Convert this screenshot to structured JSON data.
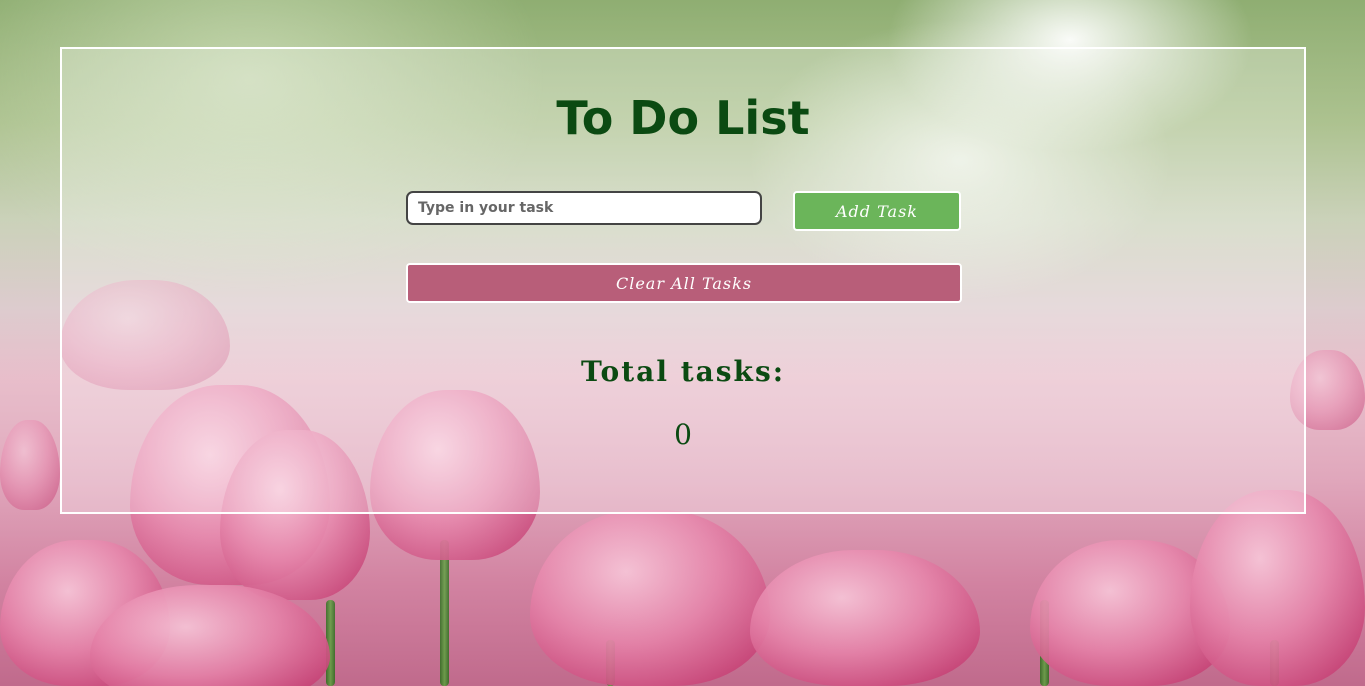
{
  "app": {
    "title": "To Do List"
  },
  "form": {
    "task_input": {
      "value": "",
      "placeholder": "Type in your task"
    },
    "add_button_label": "Add Task",
    "clear_button_label": "Clear All Tasks"
  },
  "summary": {
    "total_label": "Total tasks:",
    "total_count": "0"
  },
  "colors": {
    "title_text": "#0b4a12",
    "add_button": "#6bb55a",
    "clear_button": "#b85e79",
    "panel_border": "#ffffff"
  },
  "background": {
    "icon": "pink-tulips-photo"
  }
}
